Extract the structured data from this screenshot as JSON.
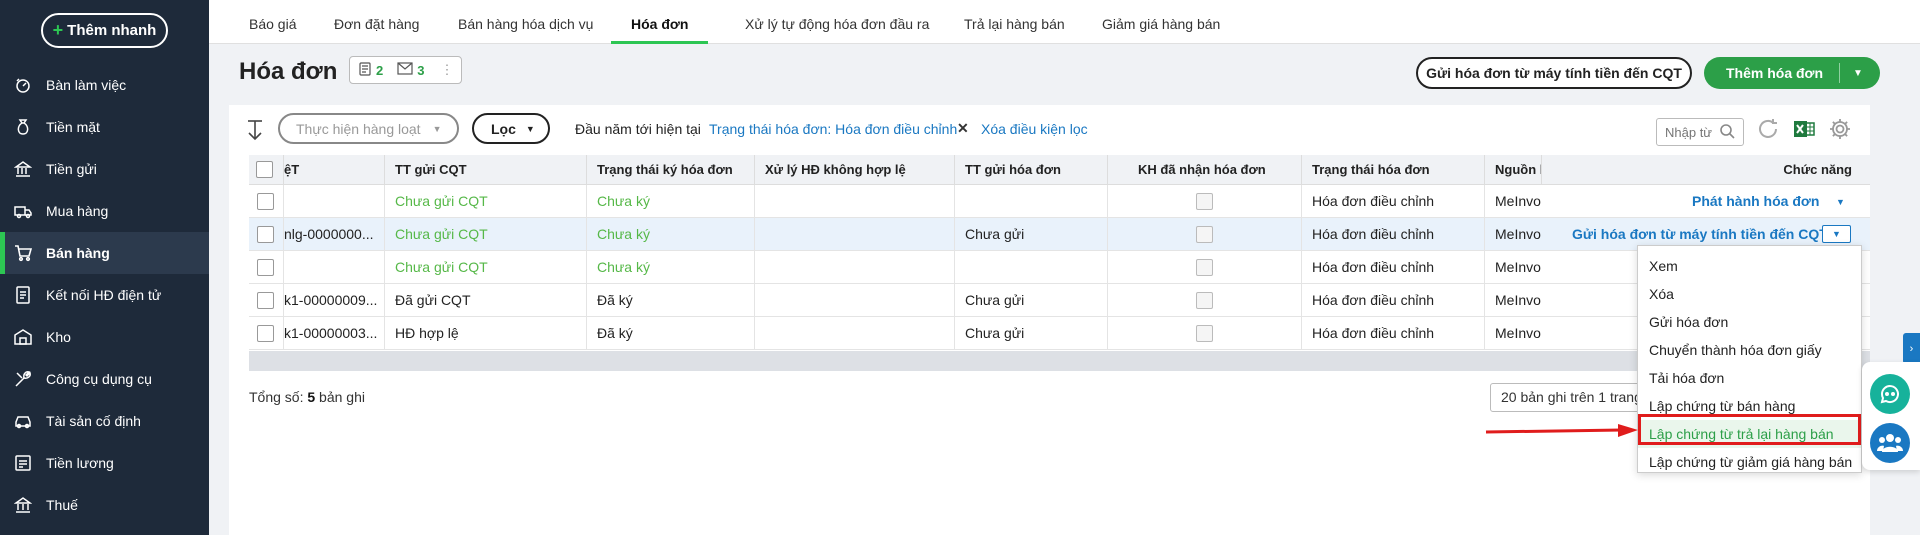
{
  "sidebar": {
    "quick_add": "Thêm nhanh",
    "items": [
      {
        "label": "Bàn làm việc",
        "icon": "dashboard-icon"
      },
      {
        "label": "Tiền mặt",
        "icon": "money-bag-icon"
      },
      {
        "label": "Tiền gửi",
        "icon": "bank-icon"
      },
      {
        "label": "Mua hàng",
        "icon": "truck-icon"
      },
      {
        "label": "Bán hàng",
        "icon": "cart-icon",
        "active": true
      },
      {
        "label": "Kết nối HĐ điện tử",
        "icon": "einvoice-icon"
      },
      {
        "label": "Kho",
        "icon": "warehouse-icon"
      },
      {
        "label": "Công cụ dụng cụ",
        "icon": "tools-icon"
      },
      {
        "label": "Tài sản cố định",
        "icon": "car-icon"
      },
      {
        "label": "Tiền lương",
        "icon": "payroll-icon"
      },
      {
        "label": "Thuế",
        "icon": "tax-icon"
      }
    ]
  },
  "tabs": [
    "Báo giá",
    "Đơn đặt hàng",
    "Bán hàng hóa dịch vụ",
    "Hóa đơn",
    "Xử lý tự động hóa đơn đầu ra",
    "Trả lại hàng bán",
    "Giảm giá hàng bán"
  ],
  "active_tab": "Hóa đơn",
  "header": {
    "title": "Hóa đơn",
    "count_a": "2",
    "count_b": "3",
    "send_btn": "Gửi hóa đơn từ máy tính tiền đến CQT",
    "add_btn": "Thêm hóa đơn"
  },
  "toolbar": {
    "batch_placeholder": "Thực hiện hàng loạt",
    "filter": "Lọc",
    "period": "Đầu năm tới hiện tại",
    "status_filter": "Trạng thái hóa đơn: Hóa đơn điều chỉnh",
    "clear_filter": "Xóa điều kiện lọc",
    "search_placeholder": "Nhập từ"
  },
  "table": {
    "headers": [
      "ệT",
      "TT gửi CQT",
      "Trạng thái ký hóa đơn",
      "Xử lý HĐ không hợp lệ",
      "TT gửi hóa đơn",
      "KH đã nhận hóa đơn",
      "Trạng thái hóa đơn",
      "Nguồn h",
      "Chức năng"
    ],
    "rows": [
      {
        "c0": "",
        "c1": "Chưa gửi CQT",
        "c2": "Chưa ký",
        "c3": "",
        "c4": "",
        "c6": "Hóa đơn điều chỉnh",
        "c7": "MeInvo",
        "fn": "Phát hành hóa đơn"
      },
      {
        "c0": "nlg-0000000...",
        "c1": "Chưa gửi CQT",
        "c2": "Chưa ký",
        "c3": "",
        "c4": "Chưa gửi",
        "c6": "Hóa đơn điều chỉnh",
        "c7": "MeInvo",
        "fn": "Gửi hóa đơn từ máy tính tiền đến CQT"
      },
      {
        "c0": "",
        "c1": "Chưa gửi CQT",
        "c2": "Chưa ký",
        "c3": "",
        "c4": "",
        "c6": "Hóa đơn điều chỉnh",
        "c7": "MeInvo",
        "fn": ""
      },
      {
        "c0": "k1-00000009...",
        "c1": "Đã gửi CQT",
        "c2": "Đã ký",
        "c3": "",
        "c4": "Chưa gửi",
        "c6": "Hóa đơn điều chỉnh",
        "c7": "MeInvo",
        "fn": ""
      },
      {
        "c0": "k1-00000003...",
        "c1": "HĐ hợp lệ",
        "c2": "Đã ký",
        "c3": "",
        "c4": "Chưa gửi",
        "c6": "Hóa đơn điều chỉnh",
        "c7": "MeInvo",
        "fn": ""
      }
    ]
  },
  "footer": {
    "total_prefix": "Tổng số: ",
    "total_count": "5",
    "total_suffix": " bản ghi",
    "pager": "20 bản ghi trên 1 trang"
  },
  "menu": {
    "items": [
      "Xem",
      "Xóa",
      "Gửi hóa đơn",
      "Chuyển thành hóa đơn giấy",
      "Tải hóa đơn",
      "Lập chứng từ bán hàng",
      "Lập chứng từ trả lại hàng bán",
      "Lập chứng từ giảm giá hàng bán"
    ],
    "highlighted": "Lập chứng từ trả lại hàng bán"
  },
  "colors": {
    "sidebar_bg": "#1e2a3a",
    "accent_green": "#2c9f48",
    "link_blue": "#1a78c2",
    "highlight_red": "#e01c1c"
  }
}
